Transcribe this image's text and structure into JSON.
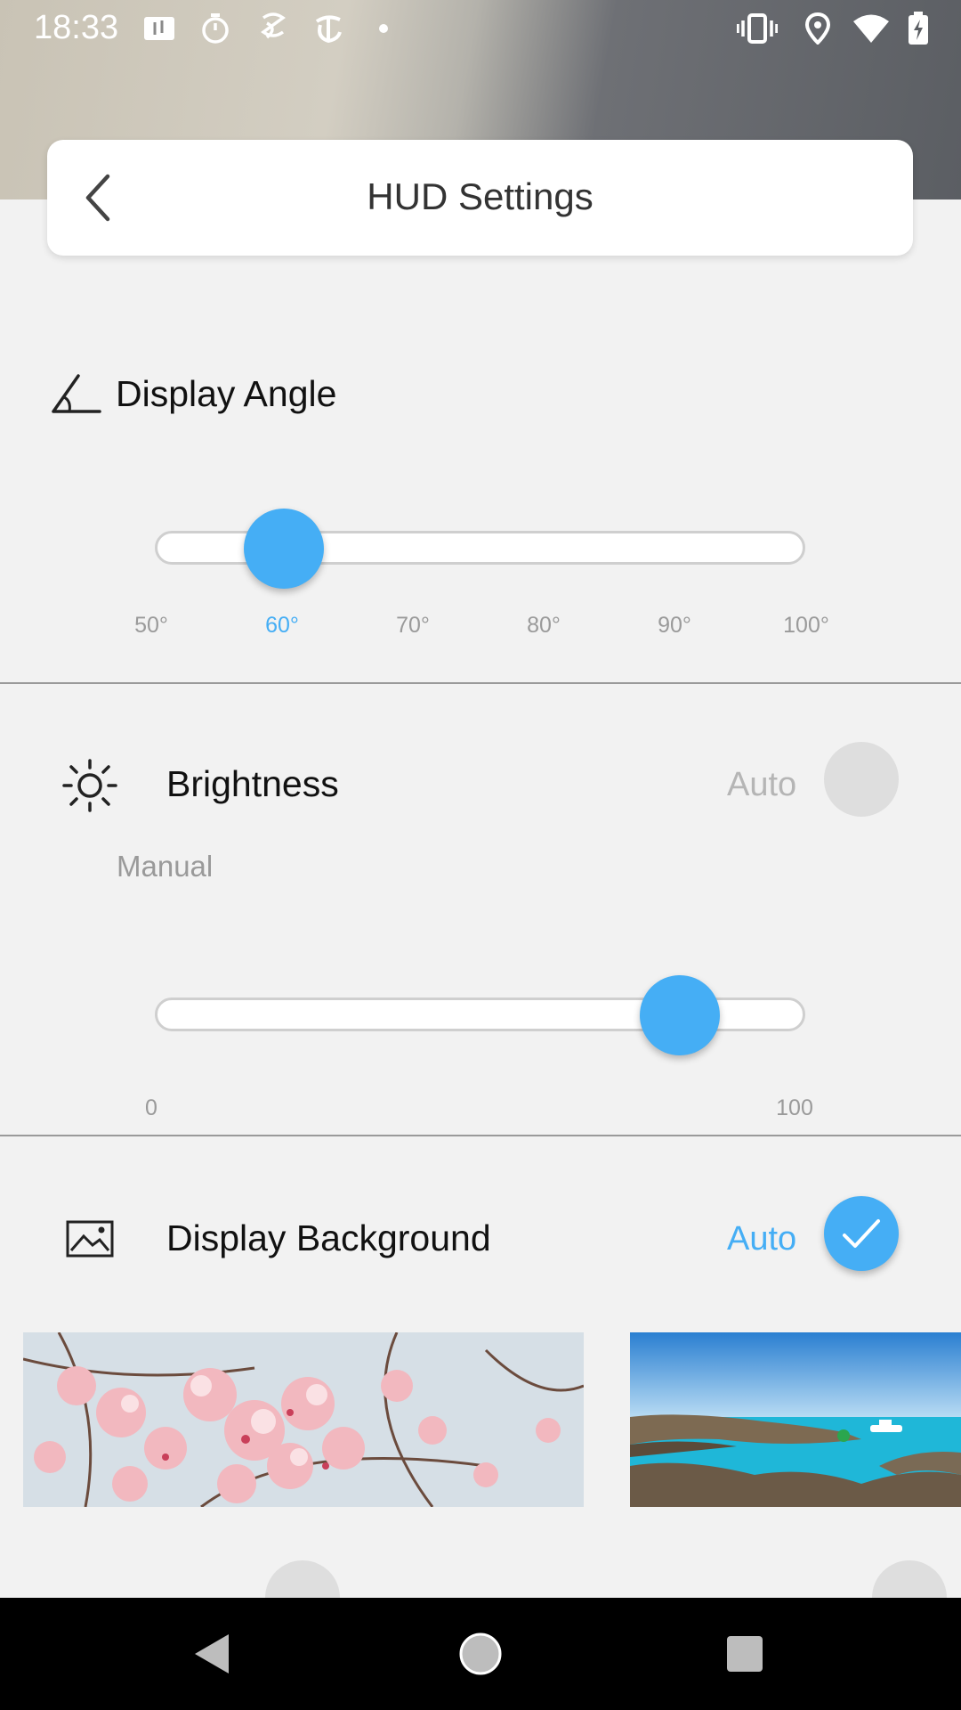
{
  "status_bar": {
    "time": "18:33",
    "left_icons": [
      "map-icon",
      "timer-icon",
      "swirl-app-icon",
      "nyt-icon",
      "dot-icon"
    ],
    "right_icons": [
      "vibrate-icon",
      "location-icon",
      "wifi-icon",
      "battery-charging-icon"
    ]
  },
  "header": {
    "title": "HUD Settings",
    "back_icon": "chevron-left-icon"
  },
  "display_angle": {
    "title": "Display Angle",
    "icon": "angle-icon",
    "ticks": [
      "50°",
      "60°",
      "70°",
      "80°",
      "90°",
      "100°"
    ],
    "selected": "60°",
    "selected_index": 1
  },
  "brightness": {
    "title": "Brightness",
    "icon": "sun-icon",
    "auto_label": "Auto",
    "auto_enabled": false,
    "mode_label": "Manual",
    "min_label": "0",
    "max_label": "100",
    "value_fraction": 0.85
  },
  "display_background": {
    "title": "Display Background",
    "icon": "image-icon",
    "auto_label": "Auto",
    "auto_enabled": true,
    "options": [
      {
        "name": "cherry-blossom"
      },
      {
        "name": "coastal-sea"
      }
    ]
  },
  "colors": {
    "accent": "#45aef5",
    "background": "#f2f2f2",
    "muted_text": "#9a9a9a"
  },
  "nav_bar": {
    "icons": [
      "back-triangle-icon",
      "home-circle-icon",
      "recents-square-icon"
    ]
  }
}
